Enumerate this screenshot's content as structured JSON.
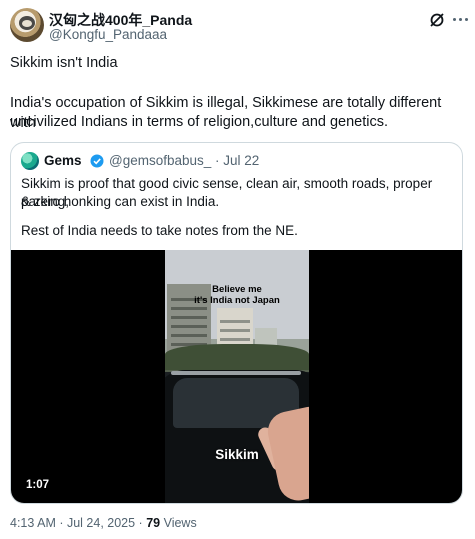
{
  "tweet": {
    "display_name": "汉匈之战400年_Panda",
    "handle": "@Kongfu_Pandaaa",
    "text_line1": "Sikkim isn't India",
    "text_line2": "India's occupation of Sikkim is illegal, Sikkimese are totally different with",
    "text_line3": "uncivilized Indians in terms of religion,culture and genetics."
  },
  "quote": {
    "name": "Gems",
    "handle_date": "@gemsofbabus_ · Jul 22",
    "text_line1": "Sikkim is proof that good civic sense, clean air, smooth roads, proper parking,",
    "text_line2": "& zero honking can exist in India.",
    "text_line3": "Rest of India needs to take notes from the NE.",
    "video": {
      "caption_line1": "Believe me",
      "caption_line2": "it's India not Japan",
      "overlay_text": "Sikkim",
      "duration": "1:07"
    }
  },
  "meta": {
    "time_date": "4:13 AM · Jul 24, 2025 · ",
    "views_count": "79",
    "views_label": " Views"
  },
  "icons": {
    "grok": "grok-icon",
    "more": "more-dots-icon",
    "verified": "verified-badge-icon"
  },
  "colors": {
    "verified_blue": "#1d9bf0",
    "secondary_text": "#536471"
  }
}
